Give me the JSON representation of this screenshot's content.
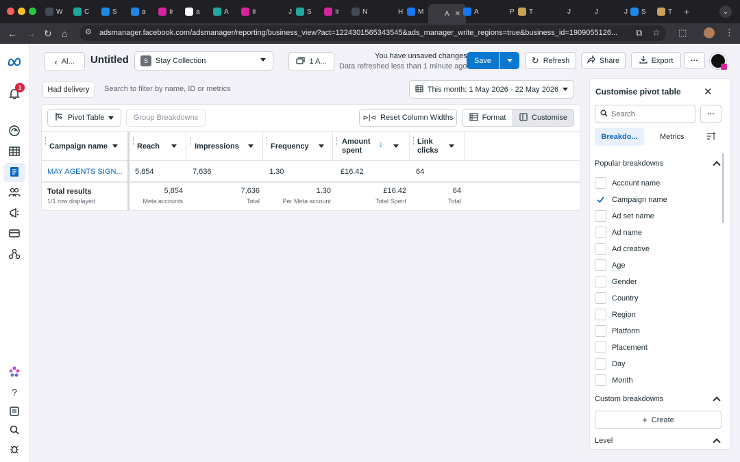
{
  "browser": {
    "tabs": [
      {
        "label": "W",
        "color": "#444a55"
      },
      {
        "label": "C",
        "color": "#1fa7a0"
      },
      {
        "label": "S",
        "color": "#1e88e5"
      },
      {
        "label": "a",
        "color": "#1e88e5"
      },
      {
        "label": "Ir",
        "color": "#d6249f"
      },
      {
        "label": "a",
        "color": "#ffffff"
      },
      {
        "label": "A",
        "color": "#1fa7a0"
      },
      {
        "label": "Ir",
        "color": "#d6249f"
      },
      {
        "label": "J",
        "color": "#1f1f24"
      },
      {
        "label": "S",
        "color": "#1fa7a0"
      },
      {
        "label": "Ir",
        "color": "#d6249f"
      },
      {
        "label": "N",
        "color": "#444a55"
      },
      {
        "label": "H",
        "color": "#1f1f24"
      },
      {
        "label": "M",
        "color": "#1877f2"
      },
      {
        "label": "A",
        "color": "#3a3a40"
      },
      {
        "label": "A",
        "color": "#1877f2"
      },
      {
        "label": "P",
        "color": "#1f1f24"
      },
      {
        "label": "T",
        "color": "#c9a15a"
      },
      {
        "label": "J",
        "color": "#1f1f24"
      },
      {
        "label": "J",
        "color": "#1f1f24"
      },
      {
        "label": "J",
        "color": "#1f1f24"
      },
      {
        "label": "S",
        "color": "#1e88e5"
      },
      {
        "label": "T",
        "color": "#c9a15a"
      }
    ],
    "active_tab_close": "✕",
    "new_tab": "+",
    "url": "adsmanager.facebook.com/adsmanager/reporting/business_view?act=1224301565343545&ads_manager_write_regions=true&business_id=1909055126..."
  },
  "header": {
    "back_label": "Al...",
    "title": "Untitled",
    "account": {
      "chip": "S",
      "name": "Stay Collection"
    },
    "selection_label": "1 A...",
    "unsaved_line1": "You have unsaved changes",
    "unsaved_line2": "Data refreshed less than 1 minute ago",
    "save_label": "Save",
    "refresh_label": "Refresh",
    "share_label": "Share",
    "export_label": "Export",
    "more_label": "···"
  },
  "sidebar": {
    "notification_count": "1"
  },
  "filters": {
    "had_delivery": "Had delivery",
    "search_placeholder": "Search to filter by name, ID or metrics",
    "date_range": "This month: 1 May 2026 - 22 May 2026"
  },
  "toolbar": {
    "pivot_table": "Pivot Table",
    "group_breakdowns": "Group Breakdowns",
    "reset_widths": "Reset Column Widths",
    "format": "Format",
    "customise": "Customise"
  },
  "table": {
    "columns": [
      "Campaign name",
      "Reach",
      "Impressions",
      "Frequency",
      "Amount spent",
      "Link clicks"
    ],
    "sort_arrow": "↓",
    "row": {
      "campaign": "MAY AGENTS SIGN...",
      "reach": "5,854",
      "impressions": "7,636",
      "frequency": "1.30",
      "amount": "£16.42",
      "clicks": "64"
    },
    "totals": {
      "label": "Total results",
      "sub": "1/1 row displayed",
      "reach": "5,854",
      "reach_sub": "Meta accounts",
      "impressions": "7,636",
      "impressions_sub": "Total",
      "frequency": "1.30",
      "frequency_sub": "Per Meta account",
      "amount": "£16.42",
      "amount_sub": "Total Spent",
      "clicks": "64",
      "clicks_sub": "Total"
    }
  },
  "pivot_panel": {
    "title": "Customise pivot table",
    "search_placeholder": "Search",
    "tab_breakdowns": "Breakdo...",
    "tab_metrics": "Metrics",
    "popular_title": "Popular breakdowns",
    "popular_items": [
      {
        "label": "Account name",
        "checked": false
      },
      {
        "label": "Campaign name",
        "checked": true
      },
      {
        "label": "Ad set name",
        "checked": false
      },
      {
        "label": "Ad name",
        "checked": false
      },
      {
        "label": "Ad creative",
        "checked": false
      },
      {
        "label": "Age",
        "checked": false
      },
      {
        "label": "Gender",
        "checked": false
      },
      {
        "label": "Country",
        "checked": false
      },
      {
        "label": "Region",
        "checked": false
      },
      {
        "label": "Platform",
        "checked": false
      },
      {
        "label": "Placement",
        "checked": false
      },
      {
        "label": "Day",
        "checked": false
      },
      {
        "label": "Month",
        "checked": false
      }
    ],
    "custom_title": "Custom breakdowns",
    "create_label": "Create",
    "level_title": "Level"
  },
  "colors": {
    "accent": "#0a78d1",
    "link": "#0a66c2",
    "check": "#0a66c2",
    "badge": "#e41e3f"
  }
}
